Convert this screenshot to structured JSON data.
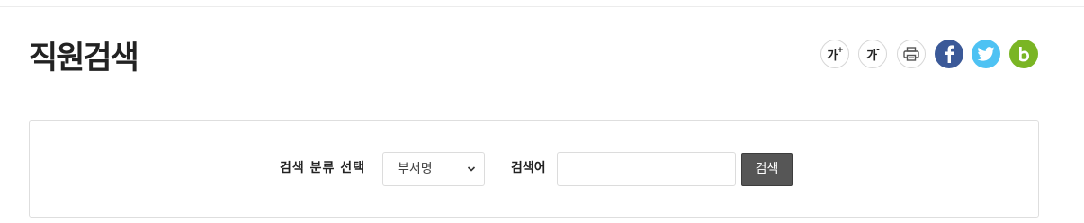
{
  "header": {
    "title": "직원검색"
  },
  "toolbar": {
    "font_increase_label": "가",
    "font_increase_sign": "+",
    "font_decrease_label": "가",
    "font_decrease_sign": "-",
    "icons": [
      "font-increase-icon",
      "font-decrease-icon",
      "print-icon",
      "facebook-icon",
      "twitter-icon",
      "band-icon"
    ],
    "colors": {
      "facebook": "#3b5998",
      "twitter": "#4ec2f3",
      "band": "#7ab524"
    }
  },
  "search": {
    "category_label": "검색 분류 선택",
    "category_selected": "부서명",
    "keyword_label": "검색어",
    "keyword_value": "",
    "keyword_placeholder": "",
    "button_label": "검색",
    "button_color": "#565656"
  }
}
